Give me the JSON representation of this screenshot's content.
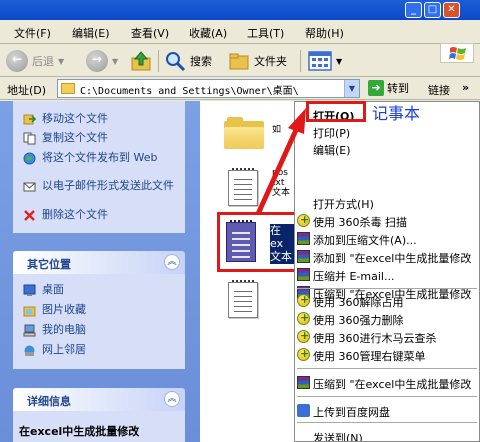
{
  "window": {
    "min_label": "_",
    "max_label": "□",
    "close_label": "✕"
  },
  "menubar": [
    "文件(F)",
    "编辑(E)",
    "查看(V)",
    "收藏(A)",
    "工具(T)",
    "帮助(H)"
  ],
  "toolbar": {
    "back_label": "后退",
    "search_label": "搜索",
    "folders_label": "文件夹"
  },
  "address": {
    "label": "地址(D)",
    "path": "C:\\Documents and Settings\\Owner\\桌面\\",
    "goto_label": "转到",
    "links_label": "链接"
  },
  "left_pane": {
    "tasks": [
      "移动这个文件",
      "复制这个文件",
      "将这个文件发布到 Web",
      "以电子邮件形式发送此文件",
      "删除这个文件"
    ],
    "other_places_title": "其它位置",
    "other_places": [
      "桌面",
      "图片收藏",
      "我的电脑",
      "网上邻居"
    ],
    "details_title": "详细信息",
    "details_name": "在excel中生成批量修改"
  },
  "files": {
    "partial_a": "如",
    "partial_b": "pos txt 文本",
    "selected_name": "在ex 文本"
  },
  "context_menu": {
    "items": [
      "打开(O)",
      "打印(P)",
      "编辑(E)",
      "打开方式(H)",
      "使用 360杀毒 扫描",
      "添加到压缩文件(A)...",
      "添加到 \"在excel中生成批量修改",
      "压缩并 E-mail...",
      "压缩到 \"在excel中生成批量修改",
      "使用 360解除占用",
      "使用 360强力删除",
      "使用 360进行木马云查杀",
      "使用 360管理右键菜单",
      "压缩到 \"在excel中生成批量修改",
      "上传到百度网盘",
      "发送到(N)"
    ]
  },
  "annotation": {
    "note": "记事本"
  },
  "colors": {
    "highlight": "#e01818",
    "selection": "#0a246a",
    "note": "#1a3fd6"
  }
}
